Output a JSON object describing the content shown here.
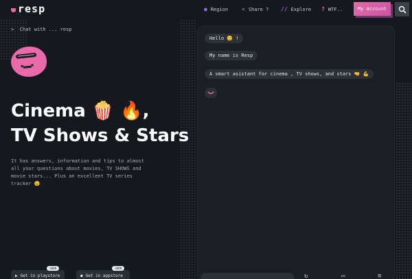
{
  "header": {
    "logo": "resp",
    "nav": [
      {
        "label": "Region",
        "icon": "globe-icon"
      },
      {
        "label": "Share ?",
        "icon": "share-icon"
      },
      {
        "label": "Explore",
        "icon": "slashes-icon"
      },
      {
        "label": "WTF..",
        "icon": "question-icon"
      }
    ],
    "account_label": "My Account",
    "search_icon": "search-icon"
  },
  "intro": {
    "chat_with": "Chat with ... resp",
    "headline_line1": "Cinema 🍿 🔥,",
    "headline_line2": "TV Shows & Stars",
    "description": "It has answers, information and tips to almost all your questions about movies, TV SHOWS and movie stars... Plus an excellent TV series tracker 😉"
  },
  "stores": [
    {
      "label": "Get in playstore",
      "badge": "SOON",
      "icon": "play-icon"
    },
    {
      "label": "Get in appstore",
      "badge": "SOON",
      "icon": "apple-icon"
    }
  ],
  "chat": {
    "messages": [
      "Hello 😊 !",
      "My name is Resp",
      "A smart asistant for cinema , TV shows, and stars 🤜 💪"
    ]
  },
  "colors": {
    "accent": "#e86aa8",
    "background": "#15181d",
    "bubble": "#2c3037"
  }
}
